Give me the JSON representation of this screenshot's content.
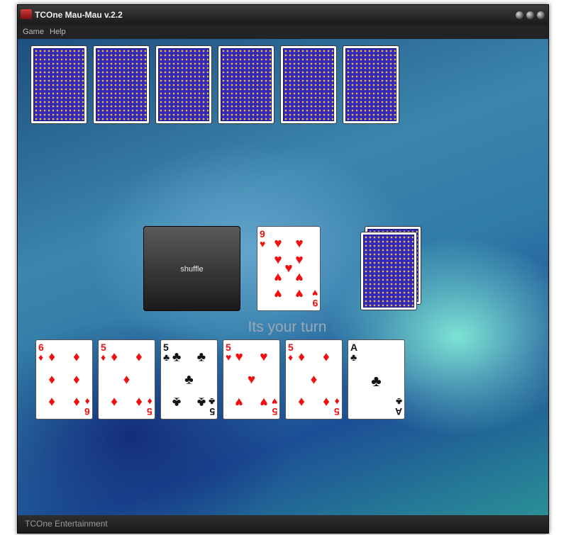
{
  "window": {
    "title": "TCOne Mau-Mau v.2.2"
  },
  "menu": [
    {
      "label": "Game"
    },
    {
      "label": "Help"
    }
  ],
  "opponent_hand": {
    "card_count": 6,
    "face": "down"
  },
  "center": {
    "shuffle_label": "shuffle",
    "discard_top": {
      "rank": "9",
      "suit": "hearts",
      "symbol": "♥",
      "color": "#ee1111"
    },
    "draw_pile": {
      "face": "down"
    }
  },
  "status_message": "Its your turn",
  "player_hand": [
    {
      "rank": "6",
      "suit": "diamonds",
      "symbol": "♦"
    },
    {
      "rank": "5",
      "suit": "diamonds",
      "symbol": "♦"
    },
    {
      "rank": "5",
      "suit": "clubs",
      "symbol": "♣"
    },
    {
      "rank": "5",
      "suit": "hearts",
      "symbol": "♥"
    },
    {
      "rank": "5",
      "suit": "diamonds",
      "symbol": "♦"
    },
    {
      "rank": "A",
      "suit": "clubs",
      "symbol": "♣"
    }
  ],
  "colors": {
    "table_accent": "#2f7aa7",
    "card_back": "#3328b8",
    "red_suit": "#ee1111",
    "black_suit": "#111111"
  },
  "status_bar": {
    "text": "TCOne Entertainment"
  }
}
